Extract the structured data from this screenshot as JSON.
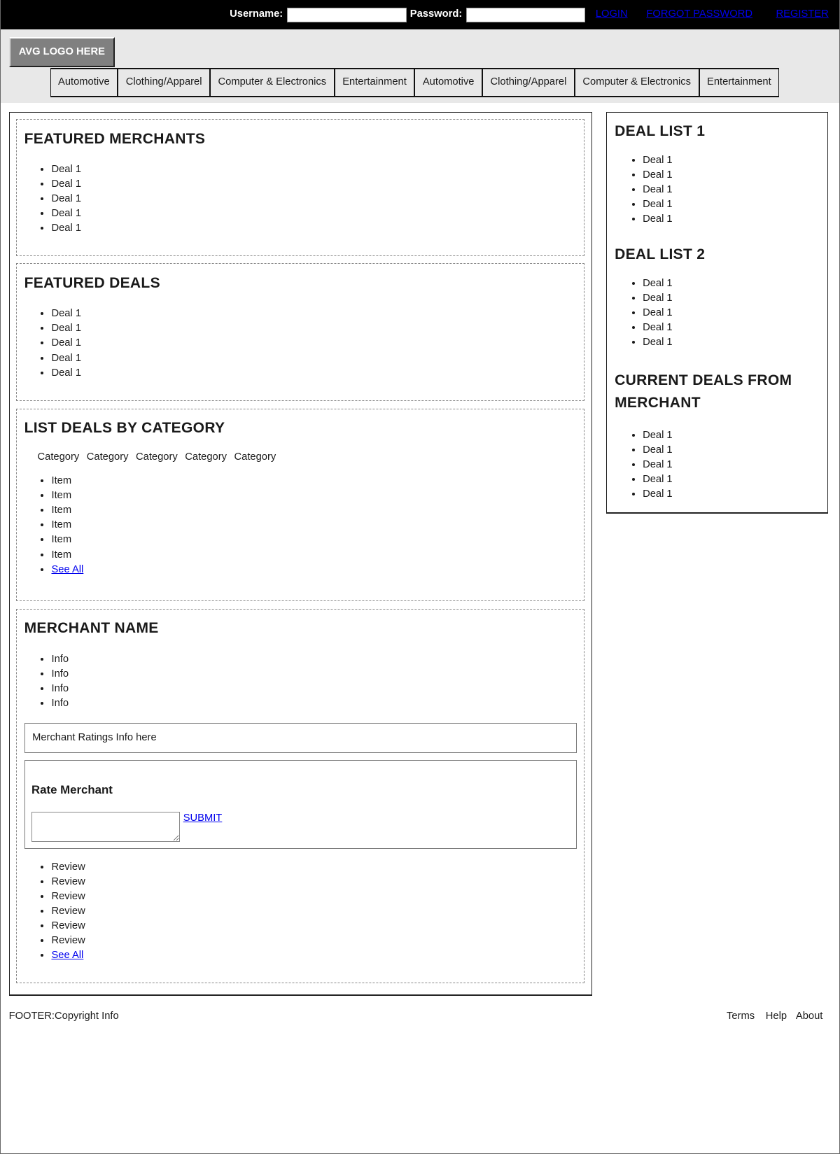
{
  "topbar": {
    "username_label": "Username:",
    "username_value": "",
    "password_label": "Password:",
    "password_value": "",
    "login": "LOGIN",
    "forgot": "FORGOT PASSWORD",
    "register": "REGISTER"
  },
  "header": {
    "logo": "AVG LOGO HERE",
    "nav": [
      "Automotive",
      "Clothing/Apparel",
      "Computer & Electronics",
      "Entertainment",
      "Automotive",
      "Clothing/Apparel",
      "Computer & Electronics",
      "Entertainment"
    ]
  },
  "featured_merchants": {
    "title": "FEATURED MERCHANTS",
    "items": [
      "Deal 1",
      "Deal 1",
      "Deal 1",
      "Deal 1",
      "Deal 1"
    ]
  },
  "featured_deals": {
    "title": "FEATURED DEALS",
    "items": [
      "Deal 1",
      "Deal 1",
      "Deal 1",
      "Deal 1",
      "Deal 1"
    ]
  },
  "by_category": {
    "title": "LIST DEALS BY CATEGORY",
    "categories": [
      "Category",
      "Category",
      "Category",
      "Category",
      "Category"
    ],
    "items": [
      "Item",
      "Item",
      "Item",
      "Item",
      "Item",
      "Item"
    ],
    "see_all": "See All"
  },
  "merchant": {
    "title": "MERCHANT NAME",
    "info": [
      "Info",
      "Info",
      "Info",
      "Info"
    ],
    "ratings": "Merchant Ratings Info here",
    "rate_title": "Rate Merchant",
    "rate_value": "",
    "submit": "SUBMIT",
    "reviews": [
      "Review",
      "Review",
      "Review",
      "Review",
      "Review",
      "Review"
    ],
    "see_all": "See All"
  },
  "sidebar": {
    "list1": {
      "title": "DEAL LIST 1",
      "items": [
        "Deal 1",
        "Deal 1",
        "Deal 1",
        "Deal 1",
        "Deal 1"
      ]
    },
    "list2": {
      "title": "DEAL LIST 2",
      "items": [
        "Deal 1",
        "Deal 1",
        "Deal 1",
        "Deal 1",
        "Deal 1"
      ]
    },
    "list3": {
      "title": "CURRENT DEALS FROM MERCHANT",
      "items": [
        "Deal 1",
        "Deal 1",
        "Deal 1",
        "Deal 1",
        "Deal 1"
      ]
    }
  },
  "footer": {
    "copyright": "FOOTER:Copyright Info",
    "links": [
      "Terms",
      "Help",
      "About"
    ]
  }
}
